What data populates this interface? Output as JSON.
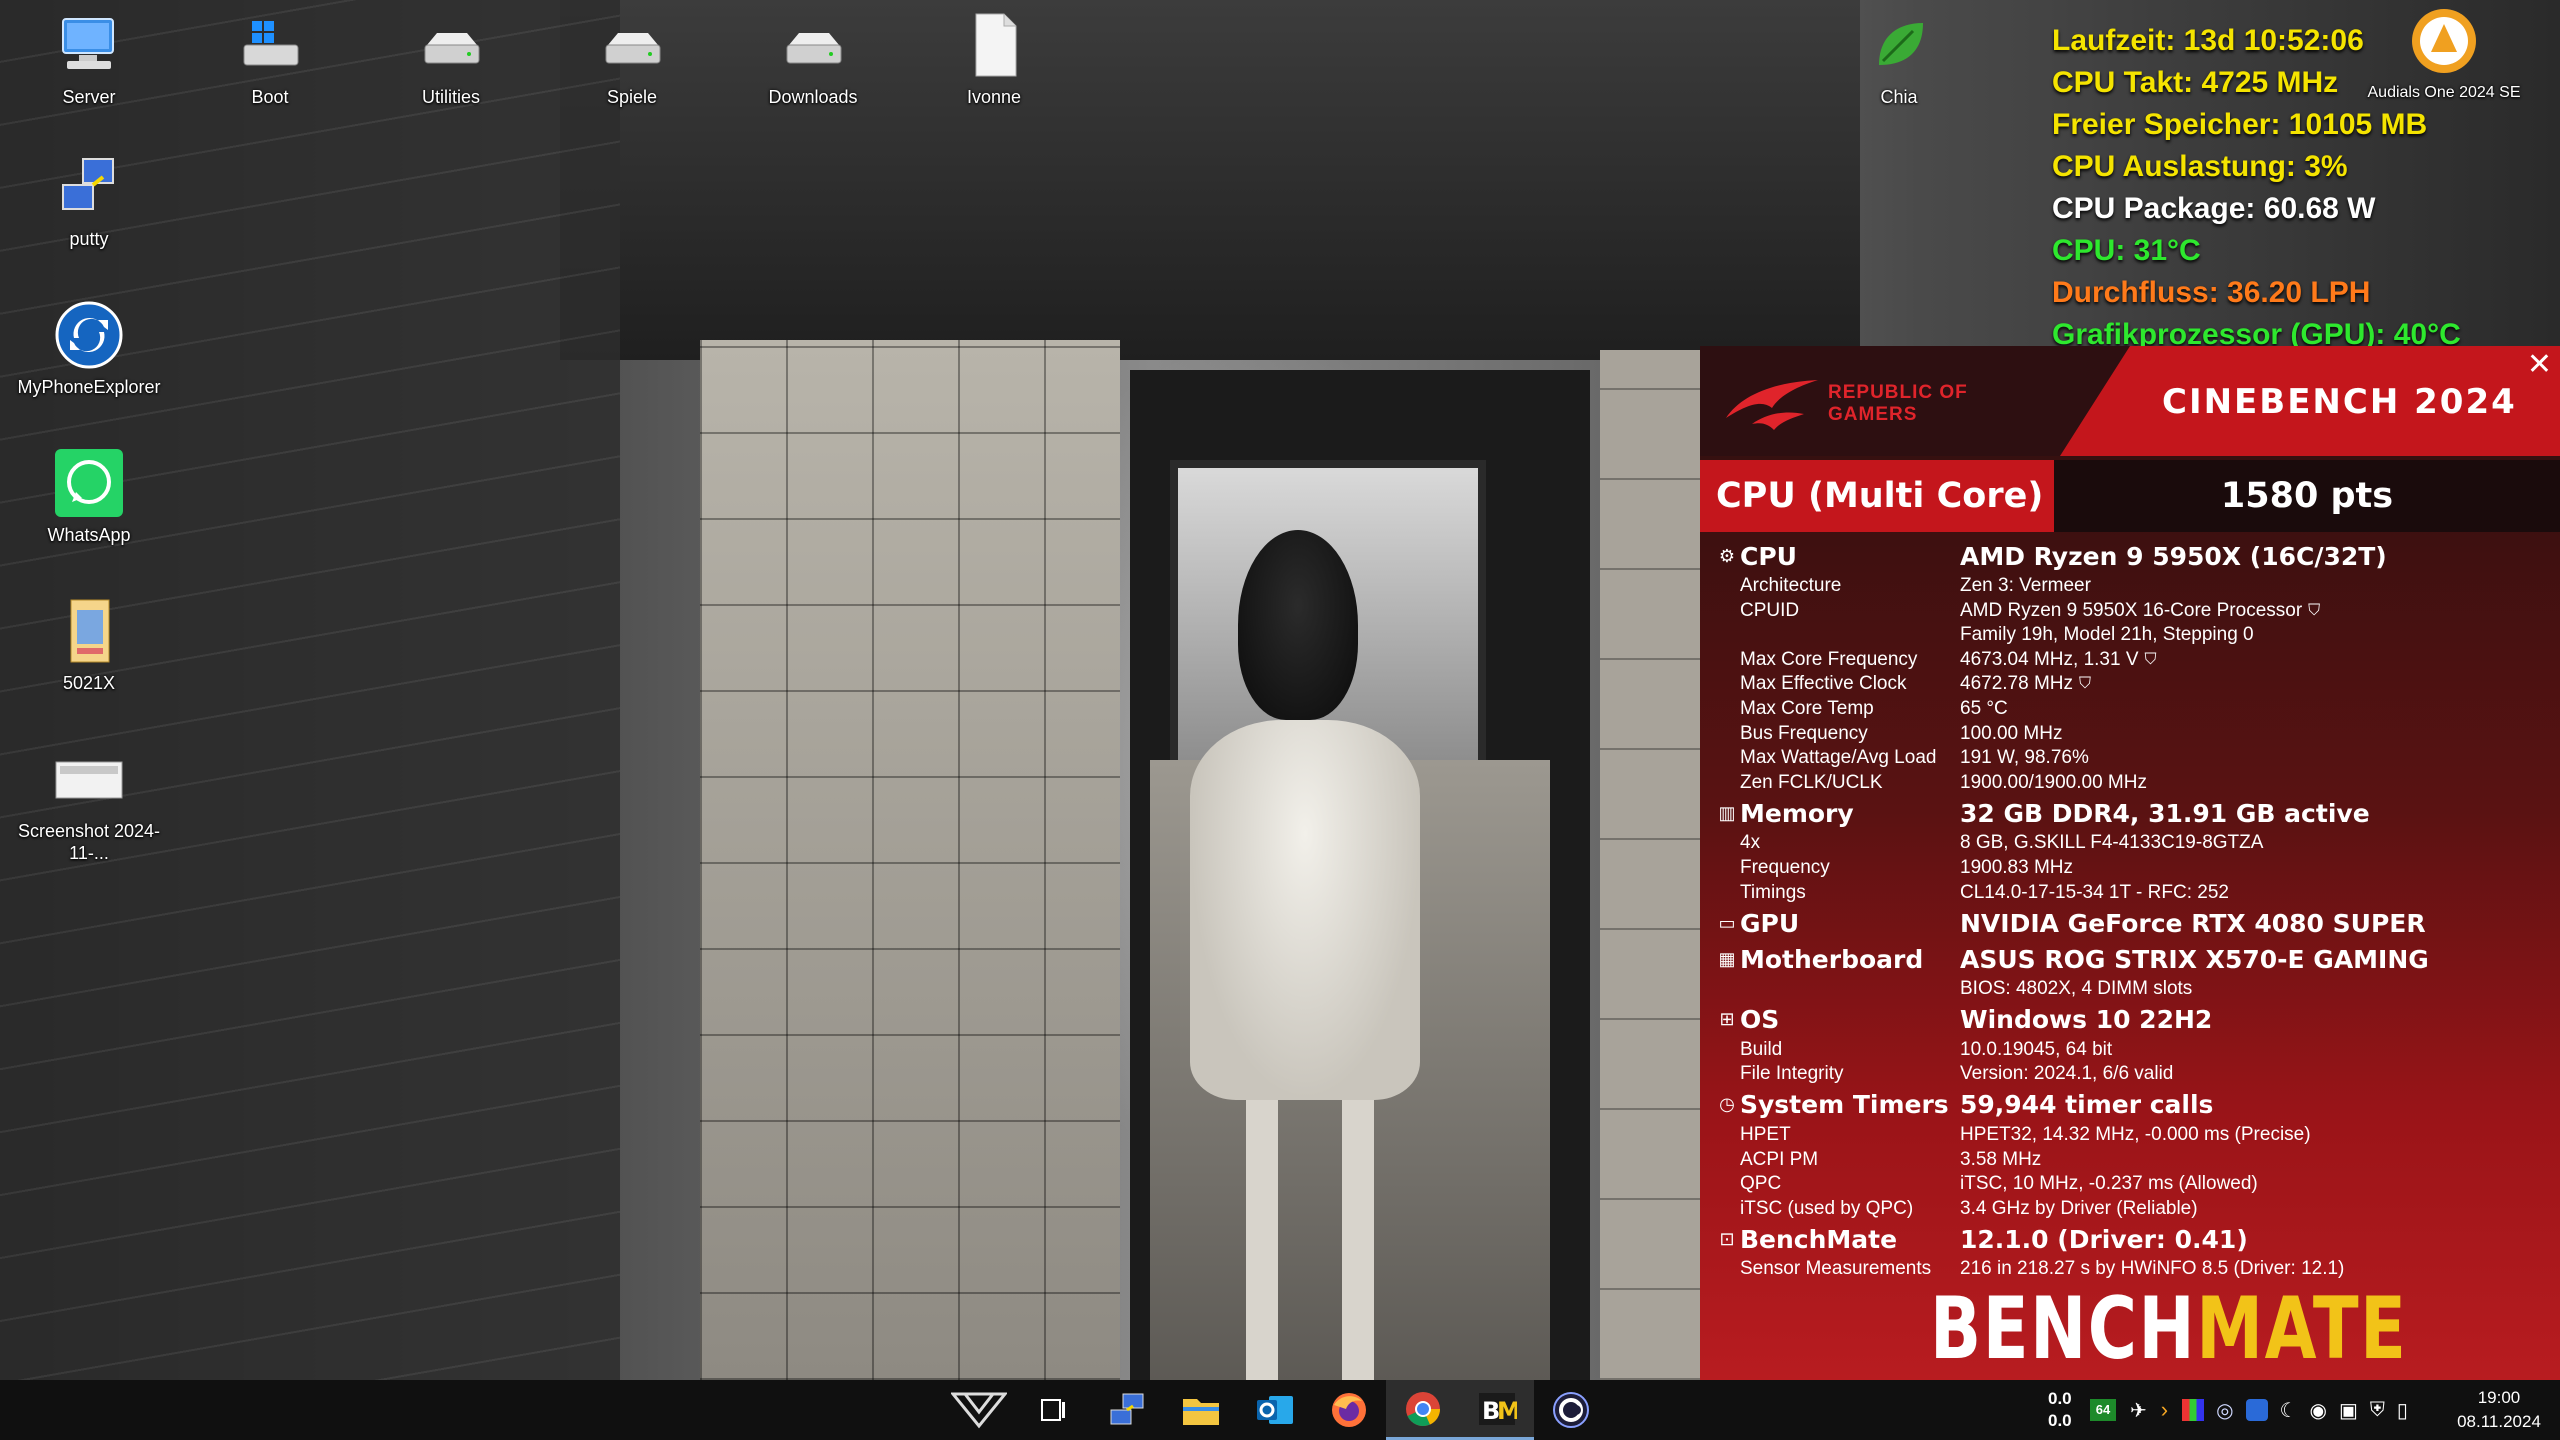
{
  "desktop": {
    "icons": [
      {
        "label": "Server",
        "icon": "monitor-icon"
      },
      {
        "label": "Boot",
        "icon": "windows-drive-icon"
      },
      {
        "label": "Utilities",
        "icon": "drive-icon"
      },
      {
        "label": "Spiele",
        "icon": "drive-icon"
      },
      {
        "label": "Downloads",
        "icon": "drive-icon"
      },
      {
        "label": "Ivonne",
        "icon": "document-icon"
      },
      {
        "label": "Chia",
        "icon": "leaf-icon"
      },
      {
        "label": "Audials One 2024 SE",
        "icon": "audials-icon"
      },
      {
        "label": "putty",
        "icon": "putty-icon"
      },
      {
        "label": "MyPhoneExplorer",
        "icon": "sync-icon"
      },
      {
        "label": "WhatsApp",
        "icon": "whatsapp-icon"
      },
      {
        "label": "5021X",
        "icon": "folder-icon"
      },
      {
        "label": "Screenshot 2024-11-...",
        "icon": "screenshot-icon"
      }
    ]
  },
  "sysinfo": {
    "lines": [
      {
        "text": "Laufzeit: 13d 10:52:06",
        "color": "#f5e400"
      },
      {
        "text": "CPU Takt: 4725 MHz",
        "color": "#f5e400"
      },
      {
        "text": "Freier Speicher: 10105 MB",
        "color": "#f5e400"
      },
      {
        "text": "CPU Auslastung: 3%",
        "color": "#f5e400"
      },
      {
        "text": "CPU Package: 60.68 W",
        "color": "#ffffff"
      },
      {
        "text": "CPU: 31°C",
        "color": "#2ee82e"
      },
      {
        "text": "Durchfluss: 36.20 LPH",
        "color": "#ff7a1a"
      },
      {
        "text": "Grafikprozessor (GPU): 40°C",
        "color": "#2ee82e"
      }
    ]
  },
  "benchmate": {
    "brand_line1": "REPUBLIC OF",
    "brand_line2": "GAMERS",
    "title": "CINEBENCH 2024",
    "score_label": "CPU (Multi Core)",
    "score_value": "1580 pts",
    "sections": [
      {
        "id": "cpu",
        "icon": "cpu-icon",
        "glyph": "⚙",
        "name": "CPU",
        "value": "AMD Ryzen 9 5950X (16C/32T)",
        "rows": [
          {
            "k": "Architecture",
            "v": "Zen 3: Vermeer"
          },
          {
            "k": "CPUID",
            "v": "AMD Ryzen 9 5950X 16-Core Processor",
            "shield": true
          },
          {
            "k": "",
            "v": "Family 19h, Model 21h, Stepping 0"
          },
          {
            "k": "Max Core Frequency",
            "v": "4673.04 MHz, 1.31 V",
            "shield": true
          },
          {
            "k": "Max Effective Clock",
            "v": "4672.78 MHz",
            "shield": true
          },
          {
            "k": "Max Core Temp",
            "v": "65 °C"
          },
          {
            "k": "Bus Frequency",
            "v": "100.00 MHz"
          },
          {
            "k": "Max Wattage/Avg Load",
            "v": "191 W, 98.76%"
          },
          {
            "k": "Zen FCLK/UCLK",
            "v": "1900.00/1900.00 MHz"
          }
        ]
      },
      {
        "id": "memory",
        "icon": "memory-icon",
        "glyph": "▥",
        "name": "Memory",
        "value": "32 GB DDR4, 31.91 GB active",
        "rows": [
          {
            "k": "4x",
            "v": "8 GB, G.SKILL F4-4133C19-8GTZA"
          },
          {
            "k": "Frequency",
            "v": "1900.83 MHz"
          },
          {
            "k": "Timings",
            "v": "CL14.0-17-15-34 1T - RFC: 252"
          }
        ]
      },
      {
        "id": "gpu",
        "icon": "gpu-icon",
        "glyph": "▭",
        "name": "GPU",
        "value": "NVIDIA GeForce RTX 4080 SUPER",
        "rows": []
      },
      {
        "id": "motherboard",
        "icon": "motherboard-icon",
        "glyph": "▦",
        "name": "Motherboard",
        "value": "ASUS ROG STRIX X570-E GAMING",
        "rows": [
          {
            "k": "",
            "v": "BIOS: 4802X, 4 DIMM slots"
          }
        ]
      },
      {
        "id": "os",
        "icon": "windows-icon",
        "glyph": "⊞",
        "name": "OS",
        "value": "Windows 10 22H2",
        "rows": [
          {
            "k": "Build",
            "v": "10.0.19045, 64 bit"
          },
          {
            "k": "File Integrity",
            "v": "Version: 2024.1, 6/6 valid"
          }
        ]
      },
      {
        "id": "timers",
        "icon": "timer-icon",
        "glyph": "◷",
        "name": "System Timers",
        "value": "59,944 timer calls",
        "rows": [
          {
            "k": "HPET",
            "v": "HPET32, 14.32 MHz, -0.000 ms (Precise)"
          },
          {
            "k": "ACPI PM",
            "v": "3.58 MHz"
          },
          {
            "k": "QPC",
            "v": "iTSC, 10 MHz, -0.237 ms (Allowed)"
          },
          {
            "k": "iTSC (used by QPC)",
            "v": "3.4 GHz by Driver (Reliable)"
          }
        ]
      },
      {
        "id": "benchmate",
        "icon": "benchmate-icon",
        "glyph": "⊡",
        "name": "BenchMate",
        "value": "12.1.0 (Driver: 0.41)",
        "rows": [
          {
            "k": "Sensor Measurements",
            "v": "216 in 218.27 s by HWiNFO 8.5 (Driver: 12.1)"
          }
        ]
      }
    ],
    "logo_bench": "BENCH",
    "logo_mate": "MATE"
  },
  "taskbar": {
    "net_up": "0.0",
    "net_down": "0.0",
    "time": "19:00",
    "date": "08.11.2024",
    "tray_badge": "64"
  }
}
